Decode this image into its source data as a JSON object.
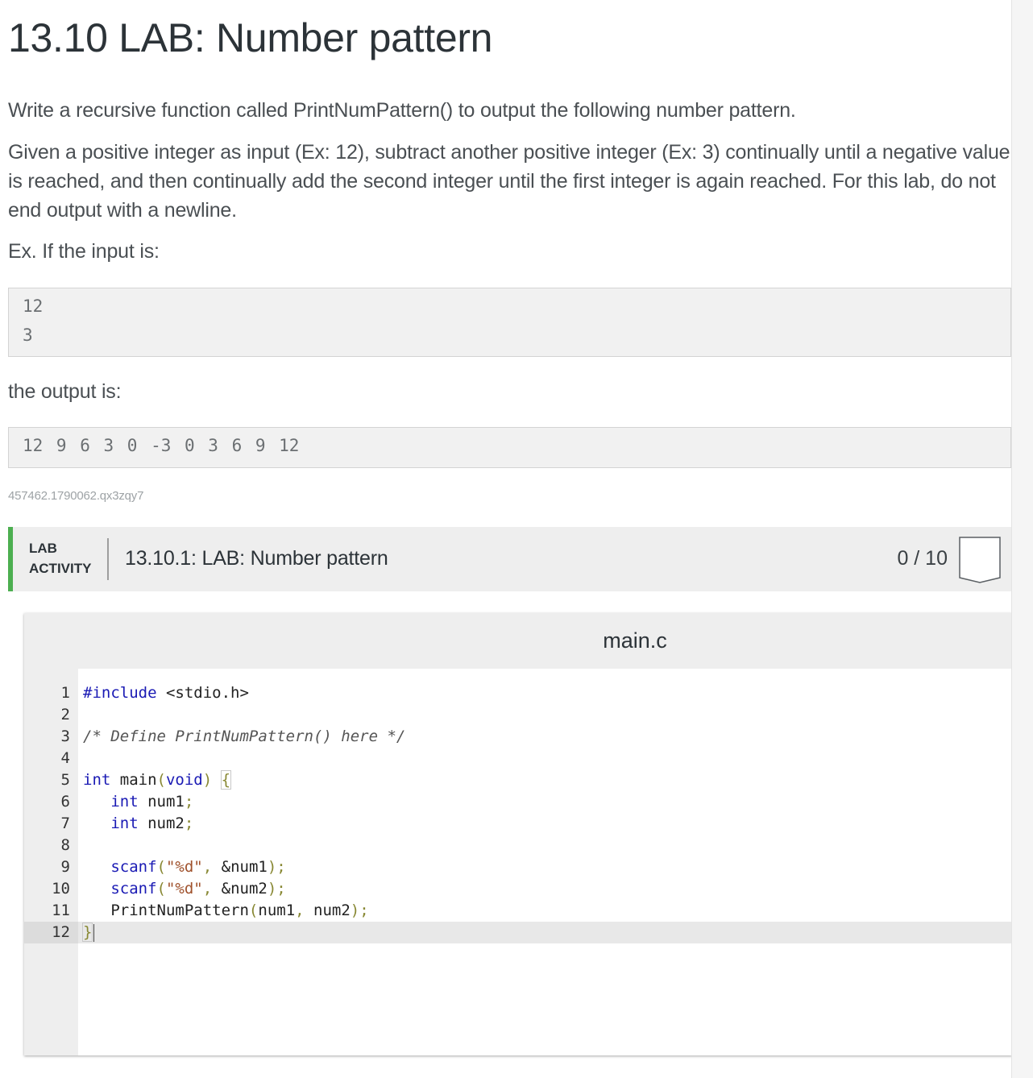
{
  "page": {
    "title": "13.10 LAB: Number pattern",
    "paragraphs": [
      "Write a recursive function called PrintNumPattern() to output the following number pattern.",
      "Given a positive integer as input (Ex: 12), subtract another positive integer (Ex: 3) continually until a negative value is reached, and then continually add the second integer until the first integer is again reached. For this lab, do not end output with a newline.",
      "Ex. If the input is:",
      "the output is:"
    ],
    "input_example": [
      "12",
      "3"
    ],
    "output_example": "12 9 6 3 0 -3 0 3 6 9 12",
    "identifier": "457462.1790062.qx3zqy7"
  },
  "lab": {
    "tag_line1": "LAB",
    "tag_line2": "ACTIVITY",
    "title": "13.10.1: LAB: Number pattern",
    "score": "0 / 10",
    "accent_color": "#4caf50",
    "badge_icon": "shield-badge-icon"
  },
  "editor": {
    "file_name": "main.c",
    "active_line": 12,
    "lines": [
      {
        "n": "1"
      },
      {
        "n": "2"
      },
      {
        "n": "3"
      },
      {
        "n": "4"
      },
      {
        "n": "5"
      },
      {
        "n": "6"
      },
      {
        "n": "7"
      },
      {
        "n": "8"
      },
      {
        "n": "9"
      },
      {
        "n": "10"
      },
      {
        "n": "11"
      },
      {
        "n": "12"
      }
    ],
    "code": {
      "l1_directive": "#include",
      "l1_header": " <stdio.h>",
      "l3_comment": "/* Define PrintNumPattern() here */",
      "l5_int": "int",
      "l5_main": " main",
      "l5_open": "(",
      "l5_void": "void",
      "l5_close": ")",
      "l5_brace": "{",
      "l6_int": "int",
      "l6_var": " num1",
      "l6_semi": ";",
      "l7_int": "int",
      "l7_var": " num2",
      "l7_semi": ";",
      "l9_fn": "scanf",
      "l9_open": "(",
      "l9_str": "\"%d\"",
      "l9_comma": ", ",
      "l9_arg": "&num1",
      "l9_close": ");",
      "l10_fn": "scanf",
      "l10_open": "(",
      "l10_str": "\"%d\"",
      "l10_comma": ", ",
      "l10_arg": "&num2",
      "l10_close": ");",
      "l11_fn": "PrintNumPattern",
      "l11_open": "(",
      "l11_arg1": "num1",
      "l11_comma": ", ",
      "l11_arg2": "num2",
      "l11_close": ");",
      "l12_brace": "}"
    }
  }
}
